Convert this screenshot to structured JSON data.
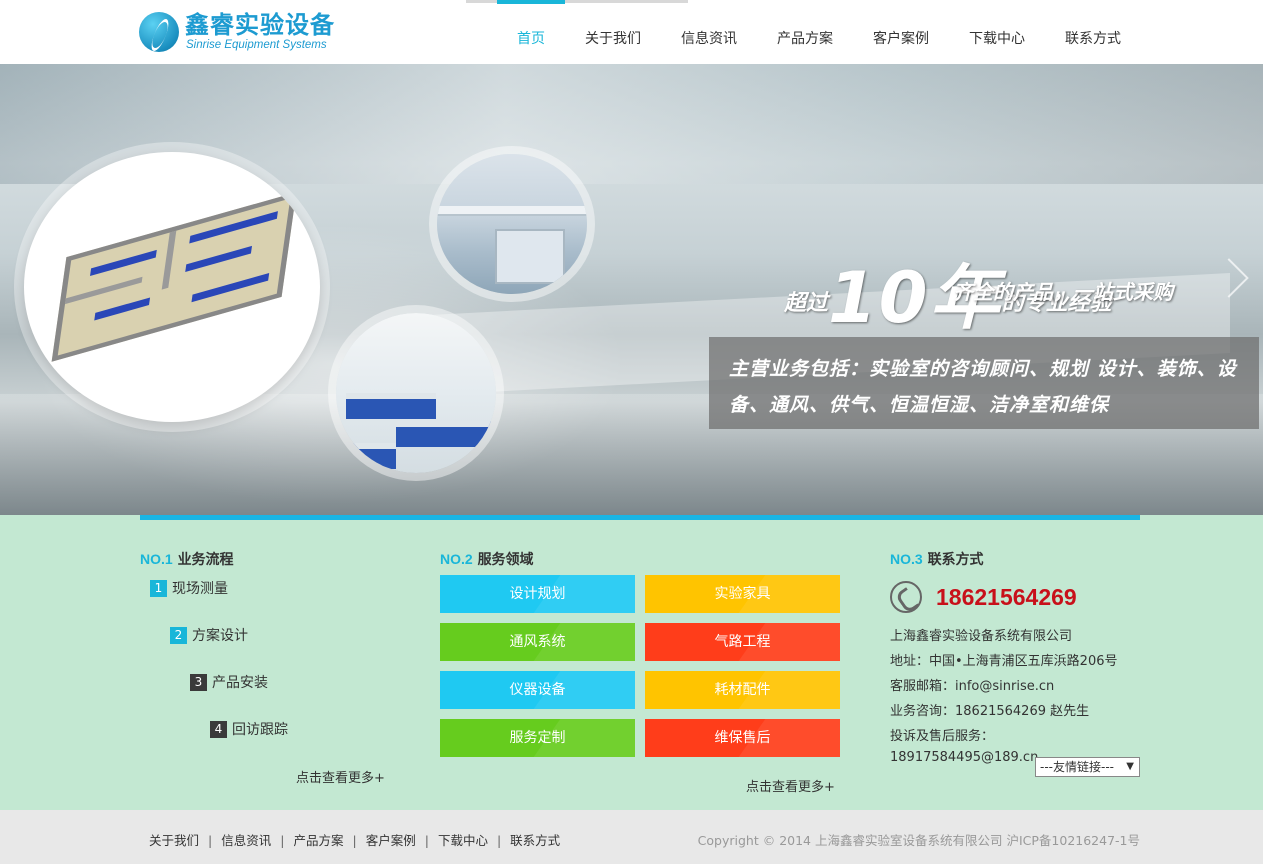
{
  "header": {
    "logo_cn": "鑫睿实验设备",
    "logo_en": "Sinrise Equipment Systems",
    "nav": [
      {
        "label": "首页",
        "active": true
      },
      {
        "label": "关于我们"
      },
      {
        "label": "信息资讯"
      },
      {
        "label": "产品方案"
      },
      {
        "label": "客户案例"
      },
      {
        "label": "下载中心"
      },
      {
        "label": "联系方式"
      }
    ]
  },
  "banner": {
    "slogan_prefix": "超过",
    "slogan_big": "10年",
    "slogan_suffix": "的专业经验",
    "slogan_line2": "齐全的产品，一站式采购",
    "business_text": "主营业务包括：实验室的咨询顾问、规划 设计、装饰、设备、通风、供气、恒温恒湿、洁净室和维保"
  },
  "col1": {
    "no": "NO.1",
    "title": "业务流程",
    "steps": [
      {
        "num": "1",
        "label": "现场测量"
      },
      {
        "num": "2",
        "label": "方案设计"
      },
      {
        "num": "3",
        "label": "产品安装"
      },
      {
        "num": "4",
        "label": "回访跟踪"
      }
    ],
    "more": "点击查看更多+"
  },
  "col2": {
    "no": "NO.2",
    "title": "服务领域",
    "buttons": [
      "设计规划",
      "实验家具",
      "通风系统",
      "气路工程",
      "仪器设备",
      "耗材配件",
      "服务定制",
      "维保售后"
    ],
    "more": "点击查看更多+"
  },
  "col3": {
    "no": "NO.3",
    "title": "联系方式",
    "phone": "18621564269",
    "company": "上海鑫睿实验设备系统有限公司",
    "address": "地址：中国•上海青浦区五库浜路206号",
    "email": "客服邮箱：info@sinrise.cn",
    "consult": "业务咨询：18621564269 赵先生",
    "complaint": "投诉及售后服务：",
    "complaint_value": "18917584495@189.cn",
    "links_select": "---友情链接---"
  },
  "footer": {
    "links": [
      "关于我们",
      "信息资讯",
      "产品方案",
      "客户案例",
      "下载中心",
      "联系方式"
    ],
    "copyright": "Copyright © 2014 上海鑫睿实验室设备系统有限公司 沪ICP备10216247-1号"
  },
  "colors": {
    "accent": "#19b6d9",
    "section_bg": "#c3e8d2",
    "phone": "#c8101a",
    "svc_blue": "#1fc9f2",
    "svc_yellow": "#ffc400",
    "svc_green": "#66cc1e",
    "svc_red": "#ff3d1a"
  }
}
